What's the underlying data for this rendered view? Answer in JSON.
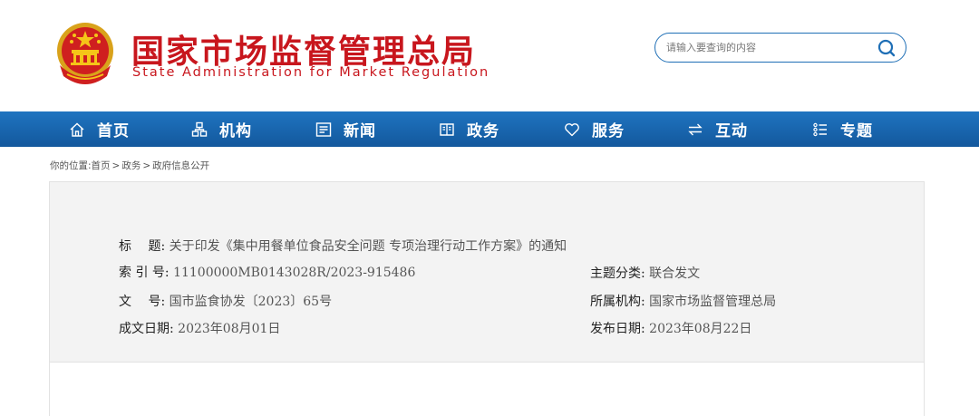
{
  "header": {
    "title": "国家市场监督管理总局",
    "subtitle": "State Administration for Market Regulation",
    "emblem_icon": "national-emblem-icon"
  },
  "search": {
    "placeholder": "请输入要查询的内容",
    "button_icon": "search-icon"
  },
  "nav": {
    "items": [
      {
        "label": "首页",
        "icon": "home-icon"
      },
      {
        "label": "机构",
        "icon": "org-chart-icon"
      },
      {
        "label": "新闻",
        "icon": "news-icon"
      },
      {
        "label": "政务",
        "icon": "government-affairs-icon"
      },
      {
        "label": "服务",
        "icon": "heart-icon"
      },
      {
        "label": "互动",
        "icon": "interaction-arrows-icon"
      },
      {
        "label": "专题",
        "icon": "topic-list-icon"
      }
    ]
  },
  "breadcrumb": {
    "prefix": "你的位置:",
    "items": [
      "首页",
      "政务",
      "政府信息公开"
    ],
    "separator": ">"
  },
  "doc_info": {
    "title": {
      "label": "标　 题:",
      "value": "关于印发《集中用餐单位食品安全问题 专项治理行动工作方案》的通知"
    },
    "index_no": {
      "label": "索 引 号:",
      "value": "11100000MB0143028R/2023-915486"
    },
    "topic": {
      "label": "主题分类:",
      "value": "联合发文"
    },
    "doc_no": {
      "label": "文　 号:",
      "value": "国市监食协发〔2023〕65号"
    },
    "agency": {
      "label": "所属机构:",
      "value": "国家市场监督管理总局"
    },
    "created": {
      "label": "成文日期:",
      "value": "2023年08月01日"
    },
    "published": {
      "label": "发布日期:",
      "value": "2023年08月22日"
    }
  },
  "colors": {
    "brand_red": "#c8161d",
    "nav_blue": "#1a67b0",
    "box_bg": "#f3f3f3"
  }
}
